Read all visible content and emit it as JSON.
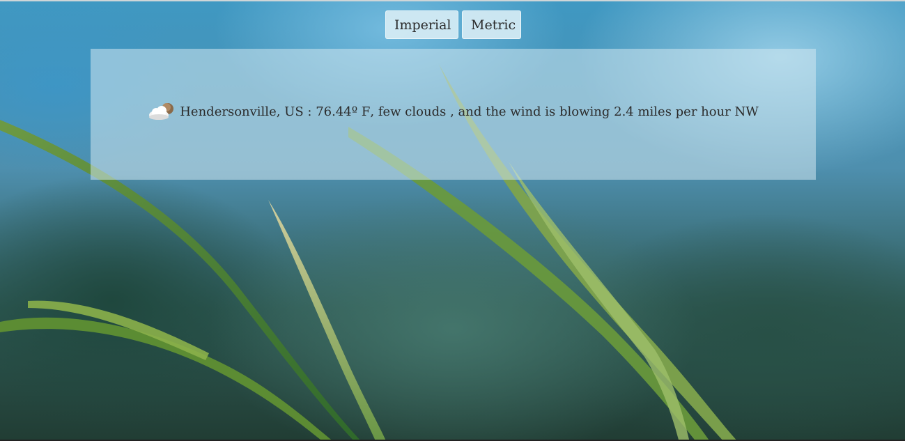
{
  "units": {
    "imperial_label": "Imperial",
    "metric_label": "Metric"
  },
  "weather": {
    "icon": "few-clouds-icon",
    "location": "Hendersonville, US",
    "separator": " : ",
    "temperature": "76.44º F",
    "conditions": "few clouds",
    "wind_text": "and the wind is blowing 2.4 miles per hour NW"
  }
}
